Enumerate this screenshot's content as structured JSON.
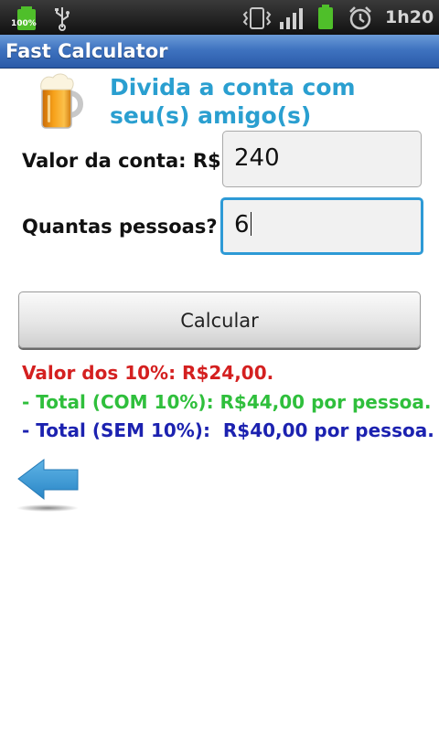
{
  "status_bar": {
    "battery_left_label": "100%",
    "time": "1h20"
  },
  "app": {
    "title": "Fast Calculator"
  },
  "header": {
    "heading": "Divida a conta com seu(s) amigo(s)",
    "icon": "beer-mug-icon"
  },
  "form": {
    "valor_label": "Valor da conta: R$",
    "valor_value": "240",
    "pessoas_label": "Quantas pessoas?",
    "pessoas_value": "6",
    "calc_button": "Calcular"
  },
  "results": {
    "tip": "Valor dos 10%: R$24,00.",
    "total_with": "- Total (COM 10%): R$44,00 por pessoa.",
    "total_without": "- Total (SEM 10%):  R$40,00 por pessoa."
  },
  "colors": {
    "heading": "#2a9fd0",
    "tip": "#d42020",
    "total_with": "#2fbf3c",
    "total_without": "#1c22b0",
    "focus_border": "#2e9ad6"
  },
  "nav": {
    "back_icon": "back-arrow-icon"
  }
}
